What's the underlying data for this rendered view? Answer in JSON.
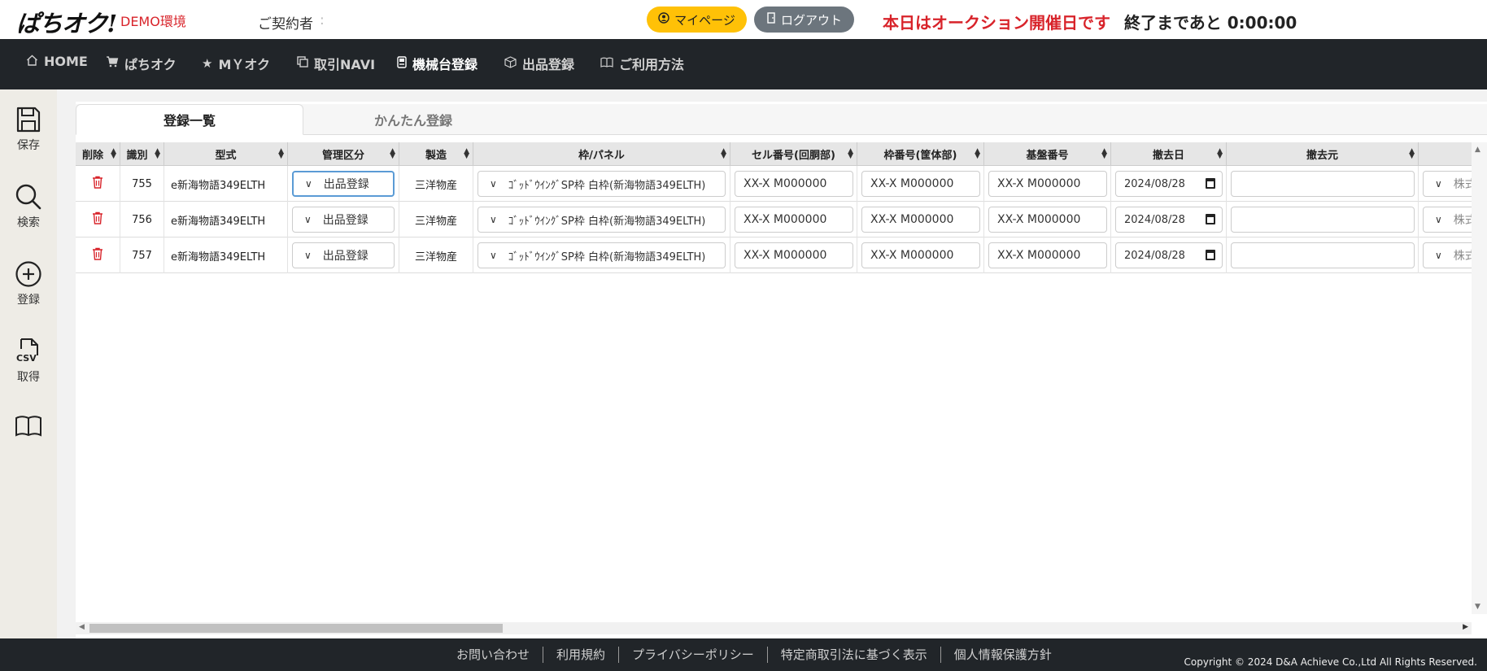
{
  "header": {
    "logo": "ぱちオク!",
    "env": "DEMO環境",
    "contractor_label": "ご契約者",
    "contractor_value": ":",
    "mypage": "マイページ",
    "logout": "ログアウト",
    "auction_msg": "本日はオークション開催日です",
    "countdown": "終了まであと 0:00:00"
  },
  "nav": {
    "items": [
      {
        "label": "HOME",
        "icon": "home-icon"
      },
      {
        "label": "ぱちオク",
        "icon": "cart-icon"
      },
      {
        "label": "MＹオク",
        "icon": "star-icon"
      },
      {
        "label": "取引NAVI",
        "icon": "copy-icon"
      },
      {
        "label": "機械台登録",
        "icon": "device-icon"
      },
      {
        "label": "出品登録",
        "icon": "box-icon"
      },
      {
        "label": "ご利用方法",
        "icon": "book-icon"
      }
    ]
  },
  "sidebar": {
    "save": "保存",
    "search": "検索",
    "register": "登録",
    "csv_icon_text": "CSV",
    "get": "取得"
  },
  "tabs": {
    "list": "登録一覧",
    "easy": "かんたん登録"
  },
  "table": {
    "headers": [
      "削除",
      "識別",
      "型式",
      "管理区分",
      "製造",
      "枠/パネル",
      "セル番号(回胴部)",
      "枠番号(筐体部)",
      "基盤番号",
      "撤去日",
      "撤去元",
      ""
    ],
    "rows": [
      {
        "id": "755",
        "model": "e新海物語349ELTH",
        "category": "出品登録",
        "maker": "三洋物産",
        "panel": "ｺﾞｯﾄﾞｳｲﾝｸﾞSP枠 白枠(新海物語349ELTH)",
        "cell": "XX-X M000000",
        "frame": "XX-X M000000",
        "board": "XX-X M000000",
        "date": "2024/08/28",
        "source": "",
        "extra": "株式"
      },
      {
        "id": "756",
        "model": "e新海物語349ELTH",
        "category": "出品登録",
        "maker": "三洋物産",
        "panel": "ｺﾞｯﾄﾞｳｲﾝｸﾞSP枠 白枠(新海物語349ELTH)",
        "cell": "XX-X M000000",
        "frame": "XX-X M000000",
        "board": "XX-X M000000",
        "date": "2024/08/28",
        "source": "",
        "extra": "株式"
      },
      {
        "id": "757",
        "model": "e新海物語349ELTH",
        "category": "出品登録",
        "maker": "三洋物産",
        "panel": "ｺﾞｯﾄﾞｳｲﾝｸﾞSP枠 白枠(新海物語349ELTH)",
        "cell": "XX-X M000000",
        "frame": "XX-X M000000",
        "board": "XX-X M000000",
        "date": "2024/08/28",
        "source": "",
        "extra": "株式"
      }
    ]
  },
  "footer": {
    "links": [
      "お問い合わせ",
      "利用規約",
      "プライバシーポリシー",
      "特定商取引法に基づく表示",
      "個人情報保護方針"
    ],
    "copyright": "Copyright © 2024 D&A Achieve Co.,Ltd All Rights Reserved."
  },
  "colors": {
    "accent_red": "#d8232a",
    "mypage_yellow": "#ffc107",
    "dark_bar": "#212529"
  }
}
